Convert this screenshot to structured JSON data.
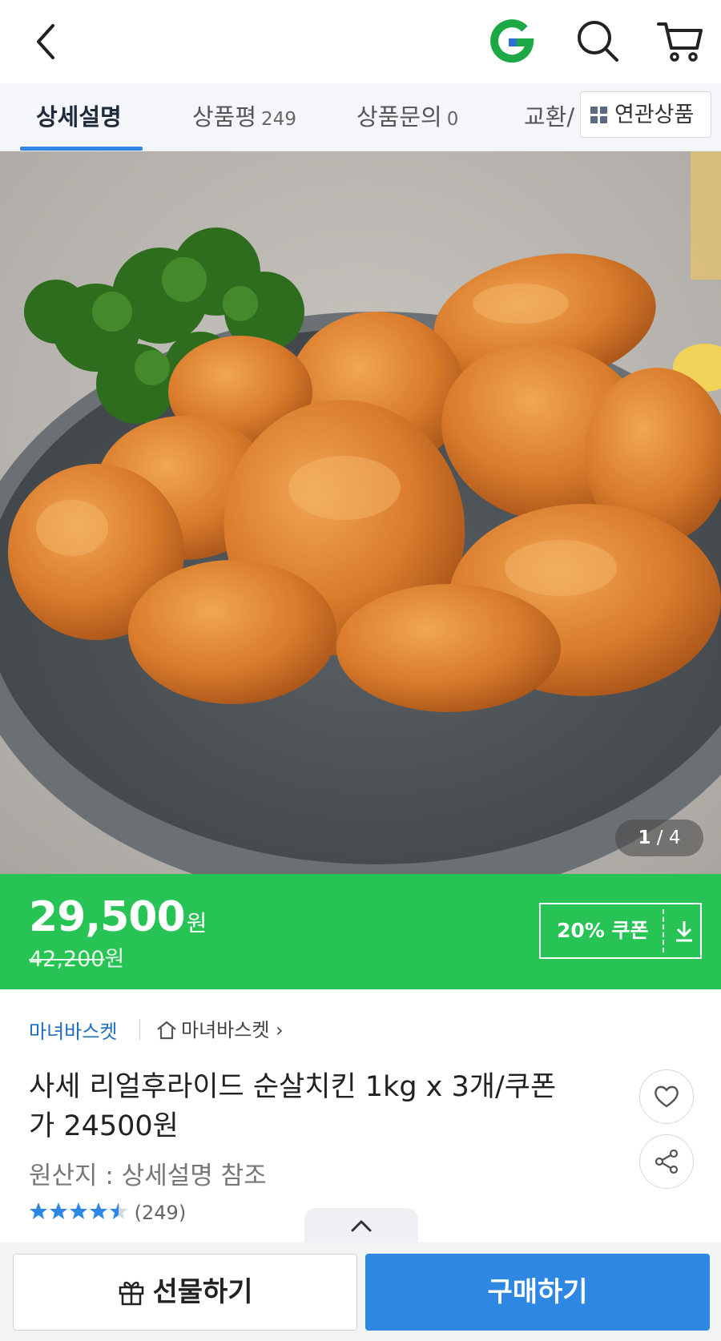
{
  "tabs": [
    {
      "label": "상세설명",
      "count": ""
    },
    {
      "label": "상품평",
      "count": "249"
    },
    {
      "label": "상품문의",
      "count": "0"
    },
    {
      "label": "교환/",
      "count": ""
    }
  ],
  "related_button": "연관상품",
  "hero": {
    "pager_current": "1",
    "pager_total": "4"
  },
  "price": {
    "current": "29,500",
    "currency": "원",
    "original": "42,200",
    "original_currency": "원"
  },
  "coupon": {
    "label": "20% 쿠폰"
  },
  "seller": {
    "name": "마녀바스켓",
    "store_link": "마녀바스켓"
  },
  "product": {
    "title": "사세 리얼후라이드 순살치킨 1kg x 3개/쿠폰가 24500원",
    "origin": "원산지 : 상세설명 참조",
    "rating": 4.5,
    "review_count": "(249)"
  },
  "actions": {
    "gift": "선물하기",
    "buy": "구매하기"
  },
  "colors": {
    "brand_green": "#27c354",
    "accent_blue": "#2f87e4"
  },
  "icons": [
    "back-icon",
    "gmarket-logo-icon",
    "search-icon",
    "cart-icon",
    "grid-icon",
    "download-icon",
    "home-icon",
    "heart-icon",
    "share-icon",
    "chevron-up-icon",
    "gift-icon",
    "star-icon"
  ]
}
